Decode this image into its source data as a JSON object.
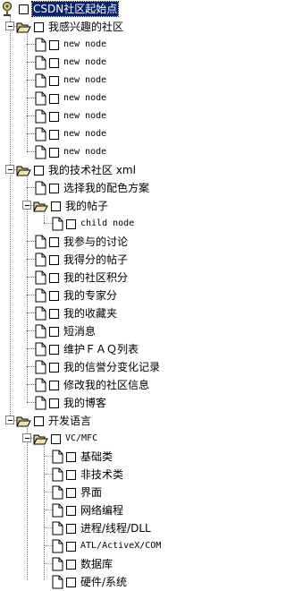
{
  "tree": {
    "root": {
      "label": "CSDN社区起始点"
    },
    "folders": [
      {
        "label": "我感兴趣的社区"
      },
      {
        "label": "我的技术社区 xml"
      },
      {
        "label": "我的帖子"
      },
      {
        "label": "开发语言"
      },
      {
        "label": "VC/MFC"
      }
    ],
    "interest_items": [
      {
        "label": "new node"
      },
      {
        "label": "new node"
      },
      {
        "label": "new node"
      },
      {
        "label": "new node"
      },
      {
        "label": "new node"
      },
      {
        "label": "new node"
      },
      {
        "label": "new node"
      }
    ],
    "tech_items": [
      {
        "label": "选择我的配色方案"
      },
      {
        "label": "child node"
      },
      {
        "label": "我参与的讨论"
      },
      {
        "label": "我得分的帖子"
      },
      {
        "label": "我的社区积分"
      },
      {
        "label": "我的专家分"
      },
      {
        "label": "我的收藏夹"
      },
      {
        "label": "短消息"
      },
      {
        "label": "维护ＦＡＱ列表"
      },
      {
        "label": "我的信誉分变化记录"
      },
      {
        "label": "修改我的社区信息"
      },
      {
        "label": "我的博客"
      }
    ],
    "vc_items": [
      {
        "label": "基础类"
      },
      {
        "label": "非技术类"
      },
      {
        "label": "界面"
      },
      {
        "label": "网络编程"
      },
      {
        "label": "进程/线程/DLL"
      },
      {
        "label": "ATL/ActiveX/COM"
      },
      {
        "label": "数据库"
      },
      {
        "label": "硬件/系统"
      }
    ]
  }
}
